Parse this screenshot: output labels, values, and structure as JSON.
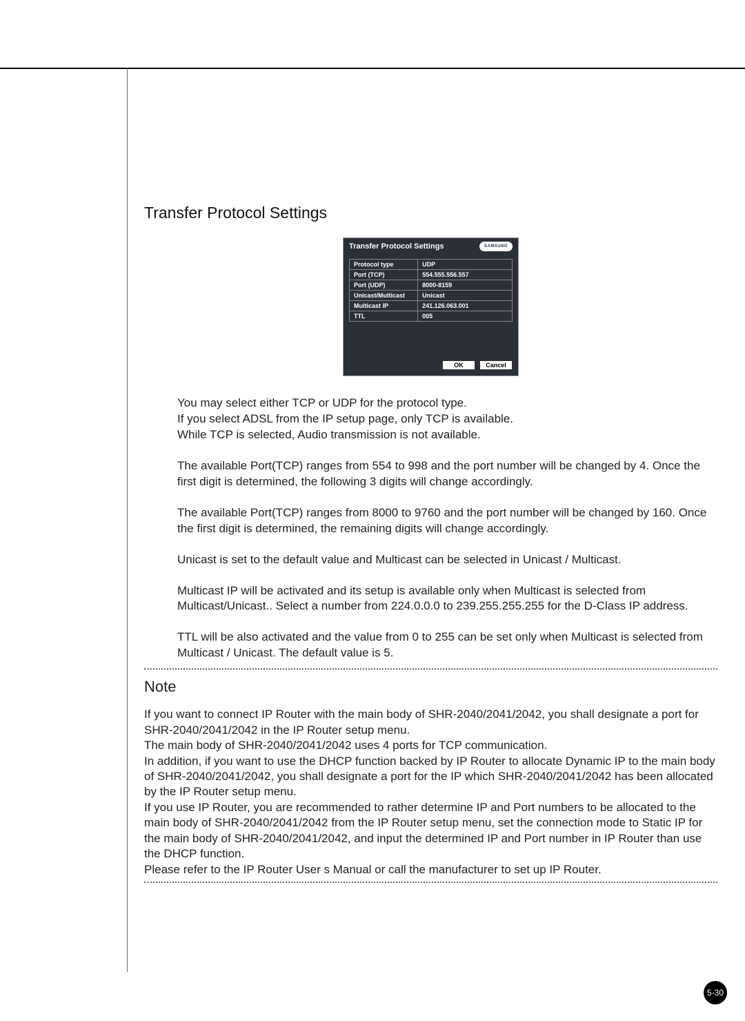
{
  "section": {
    "title": "Transfer Protocol Settings"
  },
  "dialog": {
    "title": "Transfer Protocol Settings",
    "logo": "SAMSUNG",
    "rows": [
      {
        "label": "Protocol type",
        "value": "UDP"
      },
      {
        "label": "Port (TCP)",
        "value": "554.555.556.557"
      },
      {
        "label": "Port (UDP)",
        "value": "8000-8159"
      },
      {
        "label": "Unicast/Multicast",
        "value": "Unicast"
      },
      {
        "label": "Multicast IP",
        "value": "241.126.063.001"
      },
      {
        "label": "TTL",
        "value": "005"
      }
    ],
    "ok": "OK",
    "cancel": "Cancel"
  },
  "paras": [
    "You may select either TCP or UDP for the protocol type.\nIf you select ADSL from the IP setup page, only TCP is available.\nWhile TCP is selected, Audio transmission is not available.",
    "The available Port(TCP) ranges from 554 to 998 and the port number will be changed by 4. Once the first digit is determined, the following 3 digits will change accordingly.",
    "The available Port(TCP) ranges from 8000 to 9760 and the port number will be changed by 160. Once the first digit is determined, the remaining digits will change accordingly.",
    "Unicast is set to the default value and Multicast can be selected in Unicast / Multicast.",
    "Multicast IP will be activated and its setup is available only when Multicast is selected from Multicast/Unicast.. Select a number from 224.0.0.0 to 239.255.255.255 for the D-Class IP address.",
    "TTL will be also activated and the value from 0 to 255 can be set only when Multicast is selected from Multicast / Unicast. The default value is 5."
  ],
  "note": {
    "heading": "Note",
    "text": "If you want to connect IP Router with the main body of SHR-2040/2041/2042, you shall designate a port for SHR-2040/2041/2042 in the IP Router setup menu.\nThe main body of SHR-2040/2041/2042 uses 4 ports for TCP communication.\nIn addition, if you want to use the DHCP function backed by IP Router to allocate Dynamic IP to the main body of SHR-2040/2041/2042, you shall designate a port for the IP which SHR-2040/2041/2042 has been allocated by the IP Router setup menu.\nIf you use IP Router, you are recommended to rather determine IP and Port numbers to be allocated to the main body of SHR-2040/2041/2042 from the IP Router setup menu, set the connection mode to Static IP for the main body of SHR-2040/2041/2042, and input the determined IP and Port number in IP Router than use the DHCP function.\nPlease refer to the IP Router User s Manual or call the manufacturer to set up IP Router."
  },
  "page_number": "5-30"
}
